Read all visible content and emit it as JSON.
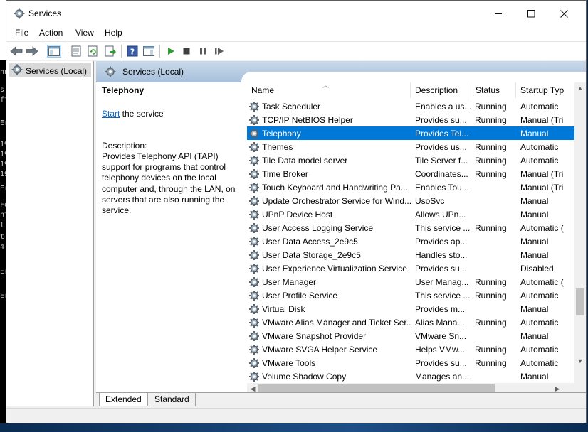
{
  "window": {
    "title": "Services"
  },
  "menu": {
    "items": [
      "File",
      "Action",
      "View",
      "Help"
    ]
  },
  "toolbar": {
    "buttons": [
      "back-icon",
      "forward-icon",
      "show-hide-console-tree-icon",
      "properties-icon",
      "refresh-icon",
      "export-list-icon",
      "help-icon",
      "action-pane-icon",
      "start-service-icon",
      "stop-service-icon",
      "pause-service-icon",
      "restart-service-icon"
    ]
  },
  "tree": {
    "root_label": "Services (Local)"
  },
  "header": {
    "title": "Services (Local)"
  },
  "details": {
    "service_name": "Telephony",
    "action_link": "Start",
    "action_suffix": " the service",
    "description_label": "Description:",
    "description": "Provides Telephony API (TAPI) support for programs that control telephony devices on the local computer and, through the LAN, on servers that are also running the service."
  },
  "columns": {
    "name": "Name",
    "description": "Description",
    "status": "Status",
    "startup": "Startup Typ"
  },
  "services": [
    {
      "name": "Task Scheduler",
      "description": "Enables a us...",
      "status": "Running",
      "startup": "Automatic"
    },
    {
      "name": "TCP/IP NetBIOS Helper",
      "description": "Provides su...",
      "status": "Running",
      "startup": "Manual (Tri"
    },
    {
      "name": "Telephony",
      "description": "Provides Tel...",
      "status": "",
      "startup": "Manual",
      "selected": true
    },
    {
      "name": "Themes",
      "description": "Provides us...",
      "status": "Running",
      "startup": "Automatic"
    },
    {
      "name": "Tile Data model server",
      "description": "Tile Server f...",
      "status": "Running",
      "startup": "Automatic"
    },
    {
      "name": "Time Broker",
      "description": "Coordinates...",
      "status": "Running",
      "startup": "Manual (Tri"
    },
    {
      "name": "Touch Keyboard and Handwriting Pa...",
      "description": "Enables Tou...",
      "status": "",
      "startup": "Manual (Tri"
    },
    {
      "name": "Update Orchestrator Service for Wind...",
      "description": "UsoSvc",
      "status": "",
      "startup": "Manual"
    },
    {
      "name": "UPnP Device Host",
      "description": "Allows UPn...",
      "status": "",
      "startup": "Manual"
    },
    {
      "name": "User Access Logging Service",
      "description": "This service ...",
      "status": "Running",
      "startup": "Automatic ("
    },
    {
      "name": "User Data Access_2e9c5",
      "description": "Provides ap...",
      "status": "",
      "startup": "Manual"
    },
    {
      "name": "User Data Storage_2e9c5",
      "description": "Handles sto...",
      "status": "",
      "startup": "Manual"
    },
    {
      "name": "User Experience Virtualization Service",
      "description": "Provides su...",
      "status": "",
      "startup": "Disabled"
    },
    {
      "name": "User Manager",
      "description": "User Manag...",
      "status": "Running",
      "startup": "Automatic ("
    },
    {
      "name": "User Profile Service",
      "description": "This service ...",
      "status": "Running",
      "startup": "Automatic"
    },
    {
      "name": "Virtual Disk",
      "description": "Provides m...",
      "status": "",
      "startup": "Manual"
    },
    {
      "name": "VMware Alias Manager and Ticket Ser...",
      "description": "Alias Mana...",
      "status": "Running",
      "startup": "Automatic"
    },
    {
      "name": "VMware Snapshot Provider",
      "description": "VMware Sn...",
      "status": "",
      "startup": "Manual"
    },
    {
      "name": "VMware SVGA Helper Service",
      "description": "Helps VMw...",
      "status": "Running",
      "startup": "Automatic"
    },
    {
      "name": "VMware Tools",
      "description": "Provides su...",
      "status": "Running",
      "startup": "Automatic"
    },
    {
      "name": "Volume Shadow Copy",
      "description": "Manages an...",
      "status": "",
      "startup": "Manual"
    }
  ],
  "tabs": [
    "Extended",
    "Standard"
  ],
  "background_fragments": [
    "nn",
    "s",
    "ft",
    "Er",
    "19",
    "19",
    "19",
    "19",
    "Er",
    "Fo",
    "nt",
    "l",
    "t",
    "4",
    "Er",
    "Er"
  ],
  "colors": {
    "selection": "#0078d7",
    "link": "#0066cc",
    "header_band": "#b9cde3",
    "start_icon": "#2e9c2e"
  }
}
